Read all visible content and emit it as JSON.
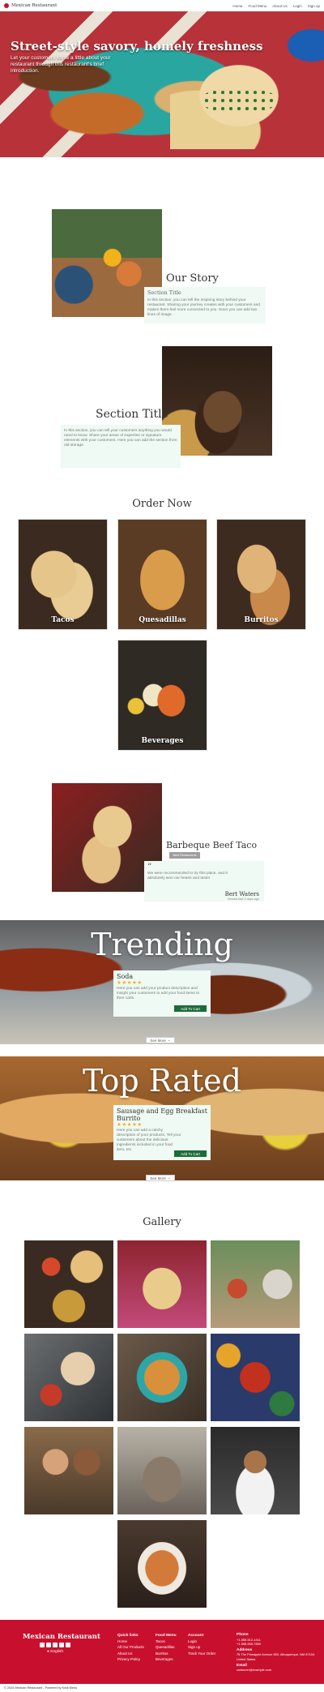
{
  "nav": {
    "brand": "Mexican Restaurant",
    "links": [
      "Home",
      "Food Menu",
      "About Us",
      "Login",
      "Sign up"
    ]
  },
  "hero": {
    "title": "Street-style savory, homely freshness",
    "intro": "Let your customers know a little about your restaurant through this restaurant's brief introduction.",
    "scroll_icon": "chevron-down-icon"
  },
  "story": {
    "title": "Our Story",
    "card_heading": "Section Title",
    "card_text": "In this section, you can tell the inspiring story behind your restaurant. Sharing your journey creates with your customers and makes them feel more connected to you. Soon you can add two lines of image."
  },
  "section2": {
    "title": "Section Title",
    "card_text": "In this section, you can tell your customers anything you would need to know. Share your areas of expertise or signature elements with your customers. Here you can add the section from old storage."
  },
  "order": {
    "title": "Order Now",
    "categories": [
      "Tacos",
      "Quesadillas",
      "Burritos",
      "Beverages"
    ]
  },
  "featured": {
    "name": "Barbeque Beef Taco",
    "badge": "Best Restaurants",
    "quote_mark": "“",
    "review": "We were recommended to try this place, and it absolutely won our hearts and taste!",
    "reviewer": "Bert Waters",
    "date": "Viewed fast 3 days ago"
  },
  "trending": {
    "title": "Trending",
    "product": "Soda",
    "stars": "★★★★★",
    "desc": "Here you can add your product description and insight your customers to add your food items to their carts.",
    "cart": "Add To Cart",
    "see_more": "See More"
  },
  "toprated": {
    "title": "Top Rated",
    "product": "Sausage and Egg Breakfast Burrito",
    "stars": "★★★★★",
    "desc": "Here you can add a catchy description of your products. Tell your customers about the delicious ingredients included in your food item, etc.",
    "cart": "Add To Cart",
    "see_more": "See More"
  },
  "gallery": {
    "title": "Gallery"
  },
  "footer": {
    "brand": "Mexican Restaurant",
    "language": "English",
    "quick_links": {
      "heading": "Quick links",
      "items": [
        "Home",
        "All Our Products",
        "About Us",
        "Privacy Policy"
      ]
    },
    "food_menu": {
      "heading": "Food Menu",
      "items": [
        "Tacos",
        "Quesadillas",
        "Burritos",
        "Beverages"
      ]
    },
    "account": {
      "heading": "Account",
      "items": [
        "Login",
        "Sign up",
        "Track Your Order"
      ]
    },
    "contact": {
      "phone_heading": "Phone",
      "phones": [
        "+1-555-512-1411",
        "+1-555-555-7890"
      ],
      "address_heading": "Address",
      "address": "75 The Pineapple Avenue 850, Albuquerque, NM 87104 United States",
      "email_heading": "Email",
      "email": "customer@example.com"
    },
    "copyright": "© 2024 Mexican Restaurant - Powered by Kwik Menu"
  },
  "colors": {
    "brand_red": "#c8102e",
    "card_bg": "#eefaf3",
    "cart_green": "#1e6b3a",
    "star": "#f2b01e"
  }
}
